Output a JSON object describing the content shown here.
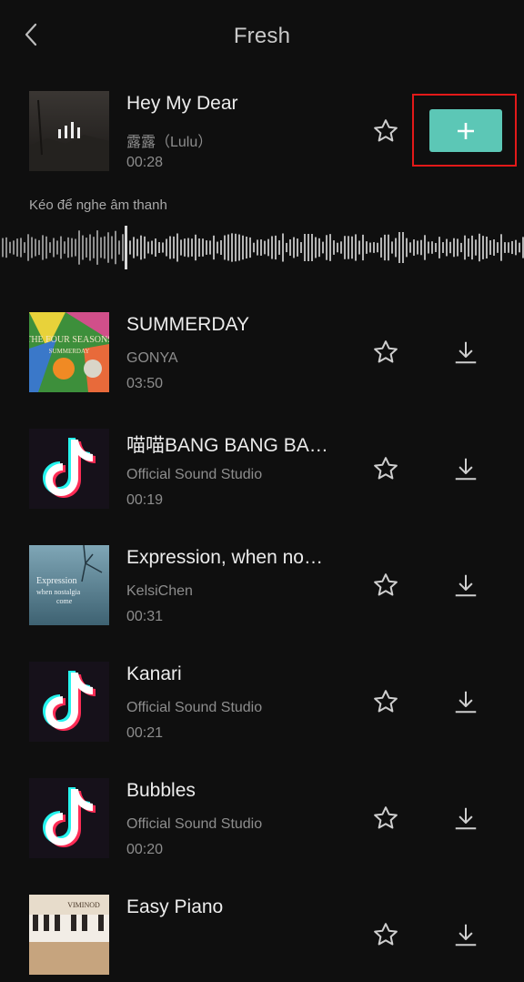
{
  "header": {
    "title": "Fresh",
    "back_icon": "chevron-left-icon"
  },
  "selected": {
    "title": "Hey My Dear",
    "artist": "露露（Lulu）",
    "duration": "00:28",
    "hint": "Kéo để nghe âm thanh",
    "add_icon": "plus-icon"
  },
  "songs": [
    {
      "title": "SUMMERDAY",
      "artist": "GONYA",
      "duration": "03:50",
      "cover": "colorful-art-cover"
    },
    {
      "title": "喵喵BANG BANG BA…",
      "artist": "Official Sound Studio",
      "duration": "00:19",
      "cover": "tiktok-logo"
    },
    {
      "title": "Expression, when no…",
      "artist": "KelsiChen",
      "duration": "00:31",
      "cover": "blue-photo-cover"
    },
    {
      "title": "Kanari",
      "artist": "Official Sound Studio",
      "duration": "00:21",
      "cover": "tiktok-logo"
    },
    {
      "title": "Bubbles",
      "artist": "Official Sound Studio",
      "duration": "00:20",
      "cover": "tiktok-logo"
    },
    {
      "title": "Easy Piano",
      "artist": "",
      "duration": "",
      "cover": "piano-cover"
    }
  ],
  "cover_text": {
    "summerday_line1": "THE FOUR SEASONS",
    "summerday_line2": "SUMMERDAY",
    "expression_line1": "Expression",
    "expression_line2": "when nostalgia",
    "expression_line3": "come",
    "piano_text": "VIMINOD"
  },
  "colors": {
    "background": "#0f0f0f",
    "accent": "#5cc7b6",
    "highlight": "#e31919",
    "muted_text": "#8d8d8d"
  },
  "icons": {
    "favorite": "star-outline-icon",
    "download": "download-icon"
  }
}
